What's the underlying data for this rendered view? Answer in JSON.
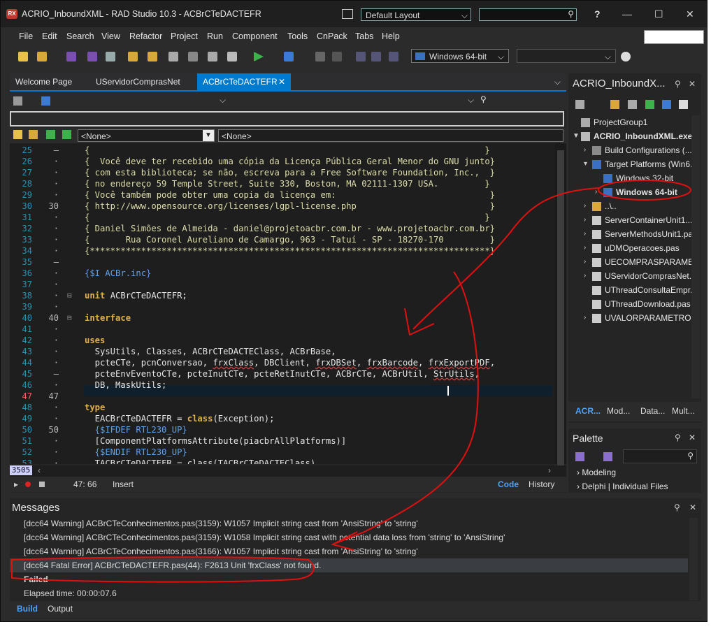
{
  "window": {
    "app_badge": "RX",
    "title": "ACRIO_InboundXML - RAD Studio 10.3 - ACBrCTeDACTEFR",
    "layout": "Default Layout",
    "help_label": "?"
  },
  "menu": [
    "File",
    "Edit",
    "Search",
    "View",
    "Refactor",
    "Project",
    "Run",
    "Component",
    "Tools",
    "CnPack",
    "Tabs",
    "Help"
  ],
  "toolbar": {
    "platform": "Windows 64-bit"
  },
  "editor": {
    "tabs": [
      {
        "label": "Welcome Page"
      },
      {
        "label": "UServidorComprasNet"
      },
      {
        "label": "ACBrCTeDACTEFR",
        "close": "✕",
        "active": true
      }
    ],
    "class_selector": "<None>",
    "method_selector": "<None>",
    "lines": [
      {
        "num": "25",
        "mark": "–",
        "fold": "",
        "segs": [
          {
            "c": "cmt",
            "t": "{                                                                             }"
          }
        ]
      },
      {
        "num": "26",
        "mark": "·",
        "fold": "",
        "segs": [
          {
            "c": "cmt",
            "t": "{  Você deve ter recebido uma cópia da Licença Pública Geral Menor do GNU junto}"
          }
        ]
      },
      {
        "num": "27",
        "mark": "·",
        "fold": "",
        "segs": [
          {
            "c": "cmt",
            "t": "{ com esta biblioteca; se não, escreva para a Free Software Foundation, Inc.,  }"
          }
        ]
      },
      {
        "num": "28",
        "mark": "·",
        "fold": "",
        "segs": [
          {
            "c": "cmt",
            "t": "{ no endereço 59 Temple Street, Suite 330, Boston, MA 02111-1307 USA.         }"
          }
        ]
      },
      {
        "num": "29",
        "mark": "·",
        "fold": "",
        "segs": [
          {
            "c": "cmt",
            "t": "{ Você também pode obter uma copia da licença em:                              }"
          }
        ]
      },
      {
        "num": "30",
        "mark": "30",
        "fold": "",
        "segs": [
          {
            "c": "cmt",
            "t": "{ http://www.opensource.org/licenses/lgpl-license.php                          }"
          }
        ]
      },
      {
        "num": "31",
        "mark": "·",
        "fold": "",
        "segs": [
          {
            "c": "cmt",
            "t": "{                                                                             }"
          }
        ]
      },
      {
        "num": "32",
        "mark": "·",
        "fold": "",
        "segs": [
          {
            "c": "cmt",
            "t": "{ Daniel Simões de Almeida - daniel@projetoacbr.com.br - www.projetoacbr.com.br}"
          }
        ]
      },
      {
        "num": "33",
        "mark": "·",
        "fold": "",
        "segs": [
          {
            "c": "cmt",
            "t": "{       Rua Coronel Aureliano de Camargo, 963 - Tatuí - SP - 18270-170         }"
          }
        ]
      },
      {
        "num": "34",
        "mark": "·",
        "fold": "",
        "segs": [
          {
            "c": "cmt",
            "t": "{******************************************************************************}"
          }
        ]
      },
      {
        "num": "35",
        "mark": "–",
        "fold": "",
        "segs": [
          {
            "c": "plain",
            "t": ""
          }
        ]
      },
      {
        "num": "36",
        "mark": "·",
        "fold": "",
        "segs": [
          {
            "c": "dir",
            "t": "{$I ACBr.inc}"
          }
        ]
      },
      {
        "num": "37",
        "mark": "·",
        "fold": "",
        "segs": [
          {
            "c": "plain",
            "t": ""
          }
        ]
      },
      {
        "num": "38",
        "mark": "·",
        "fold": "⊟",
        "segs": [
          {
            "c": "kw",
            "t": "unit"
          },
          {
            "c": "plain",
            "t": " ACBrCTeDACTEFR;"
          }
        ]
      },
      {
        "num": "39",
        "mark": "·",
        "fold": "",
        "segs": [
          {
            "c": "plain",
            "t": ""
          }
        ]
      },
      {
        "num": "40",
        "mark": "40",
        "fold": "⊟",
        "segs": [
          {
            "c": "kw",
            "t": "interface"
          }
        ]
      },
      {
        "num": "41",
        "mark": "·",
        "fold": "",
        "segs": [
          {
            "c": "plain",
            "t": ""
          }
        ]
      },
      {
        "num": "42",
        "mark": "·",
        "fold": "",
        "segs": [
          {
            "c": "kw",
            "t": "uses"
          }
        ]
      },
      {
        "num": "43",
        "mark": "·",
        "fold": "",
        "segs": [
          {
            "c": "plain",
            "t": "  SysUtils, Classes, ACBrCTeDACTEClass, ACBrBase,"
          }
        ]
      },
      {
        "num": "44",
        "mark": "·",
        "fold": "",
        "segs": [
          {
            "c": "plain",
            "t": "  pcteCTe, pcnConversao, "
          },
          {
            "c": "sq",
            "t": "frxClass"
          },
          {
            "c": "plain",
            "t": ", DBClient, "
          },
          {
            "c": "sq",
            "t": "frxDBSet"
          },
          {
            "c": "plain",
            "t": ", "
          },
          {
            "c": "sq",
            "t": "frxBarcode"
          },
          {
            "c": "plain",
            "t": ", "
          },
          {
            "c": "sq",
            "t": "frxExportPDF"
          },
          {
            "c": "plain",
            "t": ","
          }
        ]
      },
      {
        "num": "45",
        "mark": "–",
        "fold": "",
        "segs": [
          {
            "c": "plain",
            "t": "  pcteEnvEventoCTe, pcteInutCTe, pcteRetInutCTe, ACBrCTe, ACBrUtil, "
          },
          {
            "c": "sq",
            "t": "StrUtils"
          },
          {
            "c": "plain",
            "t": ","
          }
        ]
      },
      {
        "num": "46",
        "mark": "·",
        "fold": "",
        "segs": [
          {
            "c": "plain",
            "t": "  DB, MaskUtils;"
          }
        ]
      },
      {
        "num": "47",
        "mark": "47",
        "fold": "",
        "err": true,
        "segs": [
          {
            "c": "plain",
            "t": ""
          }
        ]
      },
      {
        "num": "48",
        "mark": "·",
        "fold": "",
        "segs": [
          {
            "c": "kw",
            "t": "type"
          }
        ]
      },
      {
        "num": "49",
        "mark": "·",
        "fold": "",
        "segs": [
          {
            "c": "plain",
            "t": "  EACBrCTeDACTEFR = "
          },
          {
            "c": "kw",
            "t": "class"
          },
          {
            "c": "plain",
            "t": "(Exception);"
          }
        ]
      },
      {
        "num": "50",
        "mark": "50",
        "fold": "",
        "segs": [
          {
            "c": "dir",
            "t": "  {$IFDEF RTL230_UP}"
          }
        ]
      },
      {
        "num": "51",
        "mark": "·",
        "fold": "",
        "segs": [
          {
            "c": "plain",
            "t": "  [ComponentPlatformsAttribute(piacbrAllPlatforms)]"
          }
        ]
      },
      {
        "num": "52",
        "mark": "·",
        "fold": "",
        "segs": [
          {
            "c": "dir",
            "t": "  {$ENDIF RTL230_UP}"
          }
        ]
      },
      {
        "num": "53",
        "mark": "·",
        "fold": "",
        "segs": [
          {
            "c": "plain",
            "t": "  TACBrCTeDACTEFR = class(TACBrCTeDACTEClass)"
          }
        ]
      }
    ],
    "line_count_badge": "3505",
    "cursor_pos": "47:  66",
    "insert_mode": "Insert",
    "code_tab": "Code",
    "history_tab": "History"
  },
  "project": {
    "title": "ACRIO_InboundX...",
    "tree": [
      {
        "label": "ProjectGroup1",
        "depth": 0,
        "arrow": "",
        "bold": false
      },
      {
        "label": "ACRIO_InboundXML.exe",
        "depth": 0,
        "arrow": "▼",
        "bold": true
      },
      {
        "label": "Build Configurations (...",
        "depth": 1,
        "arrow": "›",
        "bold": false
      },
      {
        "label": "Target Platforms (Win6...",
        "depth": 1,
        "arrow": "▾",
        "bold": false
      },
      {
        "label": "Windows 32-bit",
        "depth": 2,
        "arrow": "",
        "bold": false
      },
      {
        "label": "Windows 64-bit",
        "depth": 2,
        "arrow": "›",
        "bold": true
      },
      {
        "label": "..\\..",
        "depth": 1,
        "arrow": "›",
        "bold": false
      },
      {
        "label": "ServerContainerUnit1....",
        "depth": 1,
        "arrow": "›",
        "bold": false
      },
      {
        "label": "ServerMethodsUnit1.pas",
        "depth": 1,
        "arrow": "›",
        "bold": false
      },
      {
        "label": "uDMOperacoes.pas",
        "depth": 1,
        "arrow": "›",
        "bold": false
      },
      {
        "label": "UECOMPRASPARAME...",
        "depth": 1,
        "arrow": "›",
        "bold": false
      },
      {
        "label": "UServidorComprasNet....",
        "depth": 1,
        "arrow": "›",
        "bold": false
      },
      {
        "label": "UThreadConsultaEmpr...",
        "depth": 1,
        "arrow": "",
        "bold": false
      },
      {
        "label": "UThreadDownload.pas",
        "depth": 1,
        "arrow": "",
        "bold": false
      },
      {
        "label": "UVALORPARAMETRO....",
        "depth": 1,
        "arrow": "›",
        "bold": false
      }
    ],
    "tabs": [
      "ACR...",
      "Mod...",
      "Data...",
      "Mult..."
    ]
  },
  "palette": {
    "title": "Palette",
    "items": [
      "Modeling",
      "Delphi | Individual Files"
    ]
  },
  "messages": {
    "title": "Messages",
    "lines": [
      "[dcc64 Warning] ACBrCTeConhecimentos.pas(3159): W1057 Implicit string cast from 'AnsiString' to 'string'",
      "[dcc64 Warning] ACBrCTeConhecimentos.pas(3159): W1058 Implicit string cast with potential data loss from 'string' to 'AnsiString'",
      "[dcc64 Warning] ACBrCTeConhecimentos.pas(3166): W1057 Implicit string cast from 'AnsiString' to 'string'",
      "[dcc64 Fatal Error] ACBrCTeDACTEFR.pas(44): F2613 Unit 'frxClass' not found.",
      "Failed",
      "Elapsed time: 00:00:07.6"
    ],
    "tabs": [
      "Build",
      "Output"
    ]
  }
}
